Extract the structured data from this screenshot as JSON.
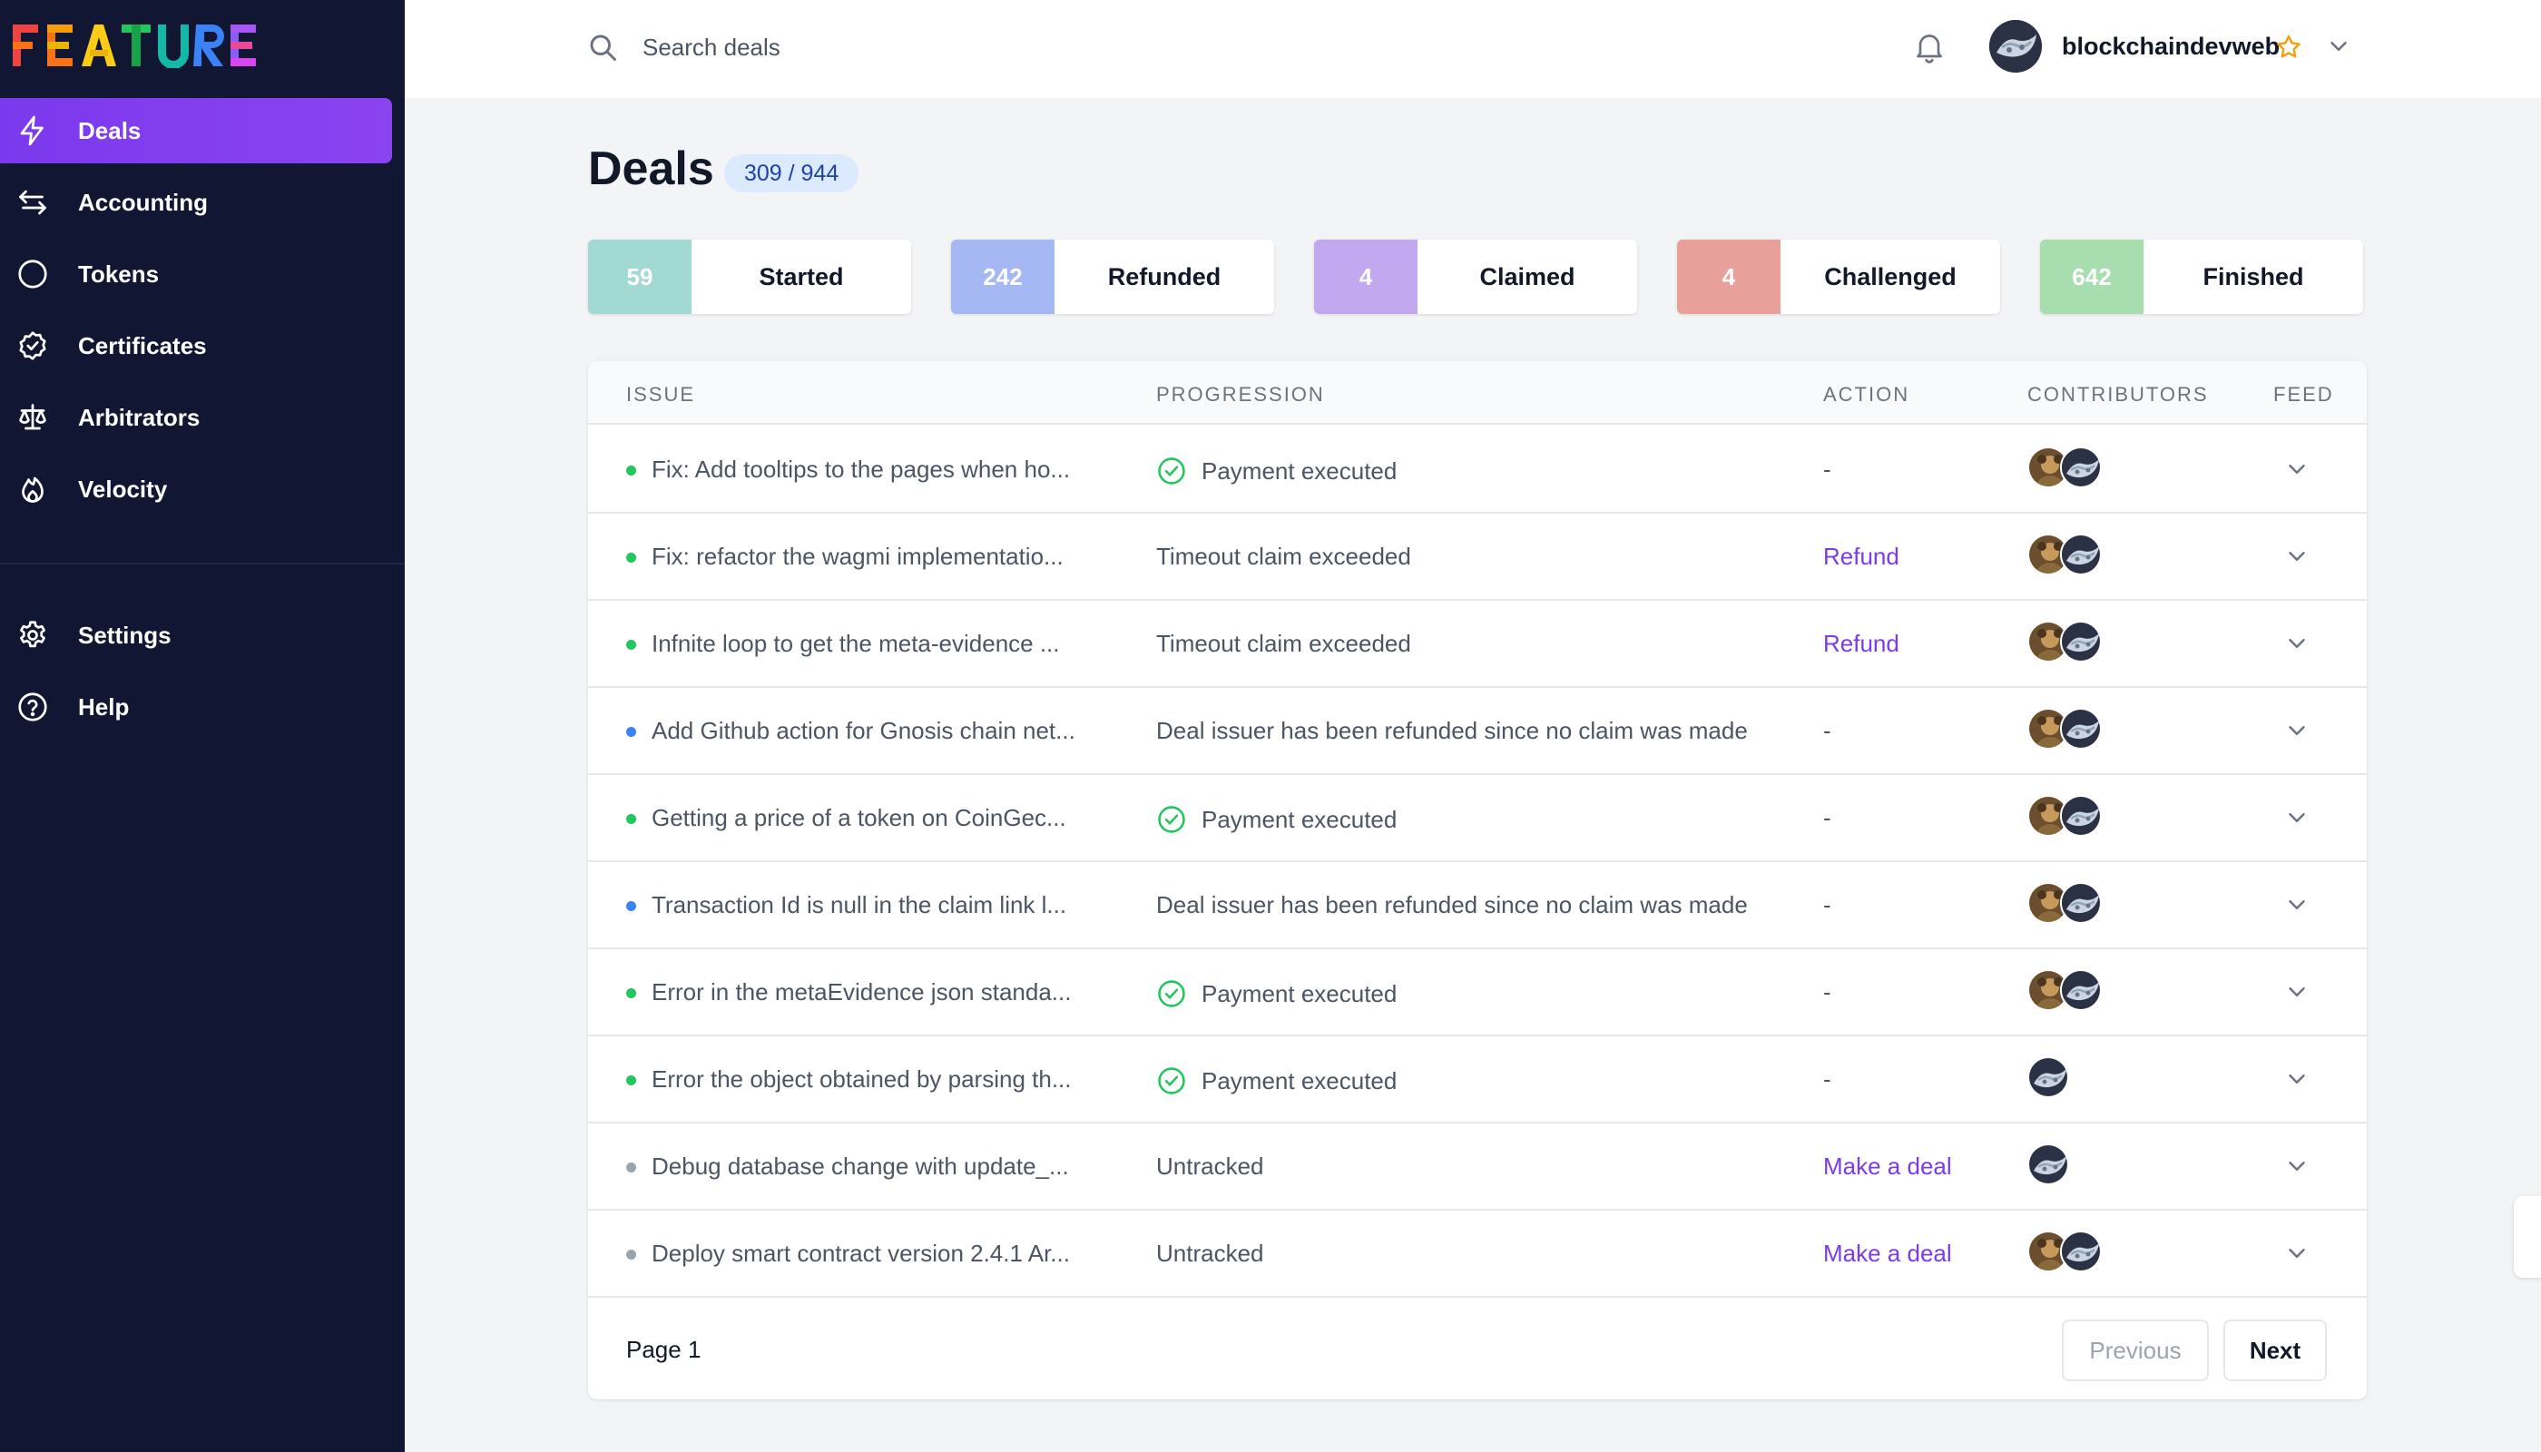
{
  "app": {
    "logo_text": "FEATURE"
  },
  "sidebar": {
    "items": [
      {
        "label": "Deals",
        "icon": "lightning-icon",
        "active": true
      },
      {
        "label": "Accounting",
        "icon": "arrows-swap-icon"
      },
      {
        "label": "Tokens",
        "icon": "circle-icon"
      },
      {
        "label": "Certificates",
        "icon": "badge-check-icon"
      },
      {
        "label": "Arbitrators",
        "icon": "scale-icon"
      },
      {
        "label": "Velocity",
        "icon": "flame-icon"
      }
    ],
    "secondary": [
      {
        "label": "Settings",
        "icon": "gear-icon"
      },
      {
        "label": "Help",
        "icon": "question-circle-icon"
      }
    ]
  },
  "topbar": {
    "search_placeholder": "Search deals",
    "username": "blockchaindevweb"
  },
  "page": {
    "title": "Deals",
    "count": "309 / 944"
  },
  "stats": [
    {
      "count": "59",
      "label": "Started",
      "color": "#a3d9d3"
    },
    {
      "count": "242",
      "label": "Refunded",
      "color": "#a5b8f3"
    },
    {
      "count": "4",
      "label": "Claimed",
      "color": "#c2a8ef"
    },
    {
      "count": "4",
      "label": "Challenged",
      "color": "#e8a09b"
    },
    {
      "count": "642",
      "label": "Finished",
      "color": "#a8ddb0"
    }
  ],
  "table": {
    "headers": {
      "issue": "ISSUE",
      "progression": "PROGRESSION",
      "action": "ACTION",
      "contributors": "CONTRIBUTORS",
      "feed": "FEED"
    },
    "rows": [
      {
        "issue": "Fix: Add tooltips to the pages when ho...",
        "status_color": "#22c55e",
        "progression": "Payment executed",
        "executed": true,
        "action": "-",
        "contributors": 2
      },
      {
        "issue": "Fix: refactor the wagmi implementatio...",
        "status_color": "#22c55e",
        "progression": "Timeout claim exceeded",
        "executed": false,
        "action": "Refund",
        "contributors": 2
      },
      {
        "issue": "Infnite loop to get the meta-evidence ...",
        "status_color": "#22c55e",
        "progression": "Timeout claim exceeded",
        "executed": false,
        "action": "Refund",
        "contributors": 2
      },
      {
        "issue": "Add Github action for Gnosis chain net...",
        "status_color": "#3b82f6",
        "progression": "Deal issuer has been refunded since no claim was made",
        "executed": false,
        "action": "-",
        "contributors": 2
      },
      {
        "issue": "Getting a price of a token on CoinGec...",
        "status_color": "#22c55e",
        "progression": "Payment executed",
        "executed": true,
        "action": "-",
        "contributors": 2
      },
      {
        "issue": "Transaction Id is null in the claim link l...",
        "status_color": "#3b82f6",
        "progression": "Deal issuer has been refunded since no claim was made",
        "executed": false,
        "action": "-",
        "contributors": 2
      },
      {
        "issue": "Error in the metaEvidence json standa...",
        "status_color": "#22c55e",
        "progression": "Payment executed",
        "executed": true,
        "action": "-",
        "contributors": 2
      },
      {
        "issue": "Error the object obtained by parsing th...",
        "status_color": "#22c55e",
        "progression": "Payment executed",
        "executed": true,
        "action": "-",
        "contributors": 1
      },
      {
        "issue": "Debug database change with update_...",
        "status_color": "#9ca3af",
        "progression": "Untracked",
        "executed": false,
        "action": "Make a deal",
        "contributors": 1
      },
      {
        "issue": "Deploy smart contract version 2.4.1 Ar...",
        "status_color": "#9ca3af",
        "progression": "Untracked",
        "executed": false,
        "action": "Make a deal",
        "contributors": 2
      }
    ]
  },
  "pagination": {
    "page_label": "Page 1",
    "previous": "Previous",
    "next": "Next"
  },
  "colors": {
    "accent": "#7c3aed",
    "sidebar_bg": "#111633",
    "success": "#22c55e"
  }
}
